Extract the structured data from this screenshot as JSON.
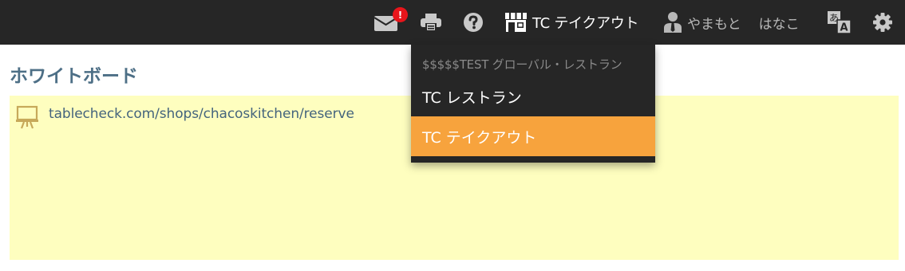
{
  "colors": {
    "topbar_bg": "#262626",
    "badge": "#e8151b",
    "highlight": "#f7a33d",
    "whiteboard_bg": "#fefebf",
    "title": "#4d6f86"
  },
  "topbar": {
    "mail": {
      "icon": "envelope-icon",
      "badge": "!"
    },
    "print": {
      "icon": "printer-icon"
    },
    "help": {
      "icon": "question-circle-icon"
    },
    "shop": {
      "icon": "storefront-icon",
      "label": "TC テイクアウト"
    },
    "user": {
      "icon": "user-tie-icon",
      "family_name": "やまもと",
      "given_name": "はなこ"
    },
    "language": {
      "icon": "translate-icon"
    },
    "settings": {
      "icon": "gear-icon"
    }
  },
  "shop_menu": {
    "header": "$$$$$TEST グローバル・レストラン",
    "items": [
      {
        "label": "TC レストラン"
      },
      {
        "label": "TC テイクアウト",
        "selected": true
      }
    ]
  },
  "main": {
    "title": "ホワイトボード",
    "whiteboard": {
      "icon": "presentation-board-icon",
      "link": "tablecheck.com/shops/chacoskitchen/reserve"
    }
  }
}
